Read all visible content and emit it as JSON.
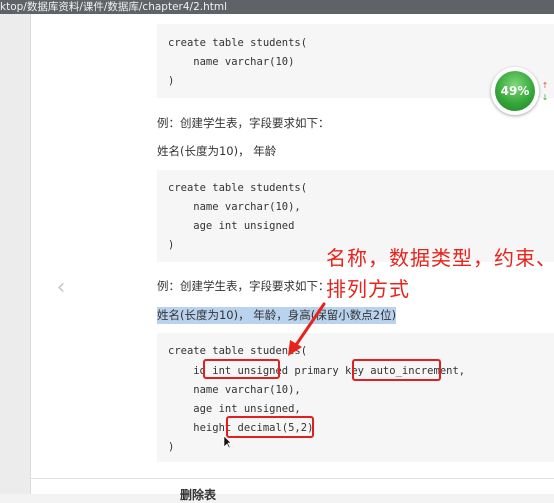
{
  "browser": {
    "url": "ktop/数据库资料/课件/数据库/chapter4/2.html"
  },
  "navigation": {
    "prev_glyph": "‹"
  },
  "code_blocks": [
    {
      "lines": [
        "create table students(",
        "    name varchar(10)",
        ")"
      ]
    },
    {
      "lines": [
        "create table students(",
        "    name varchar(10),",
        "    age int unsigned",
        ")"
      ]
    },
    {
      "lines": [
        "create table students(",
        "    id int unsigned primary key auto_increment,",
        "    name varchar(10),",
        "    age int unsigned,",
        "    height decimal(5,2)",
        ")"
      ]
    }
  ],
  "paragraphs": {
    "example_1": "例：创建学生表，字段要求如下：",
    "fields_1": "姓名(长度为10)， 年龄",
    "example_2": "例：创建学生表，字段要求如下：",
    "fields_2_highlighted": "姓名(长度为10)， 年龄，身高(保留小数点2位)"
  },
  "annotation": {
    "text": "名称，数据类型，约束、排列方式"
  },
  "gauge": {
    "percent_label": "49%",
    "up_glyph": "↑",
    "down_glyph": "↓"
  },
  "bottom": {
    "heading": "删除表"
  },
  "colors": {
    "annotation_red": "#e8231b",
    "highlight_blue": "#b9d3ef",
    "gauge_green": "#36a83a"
  }
}
